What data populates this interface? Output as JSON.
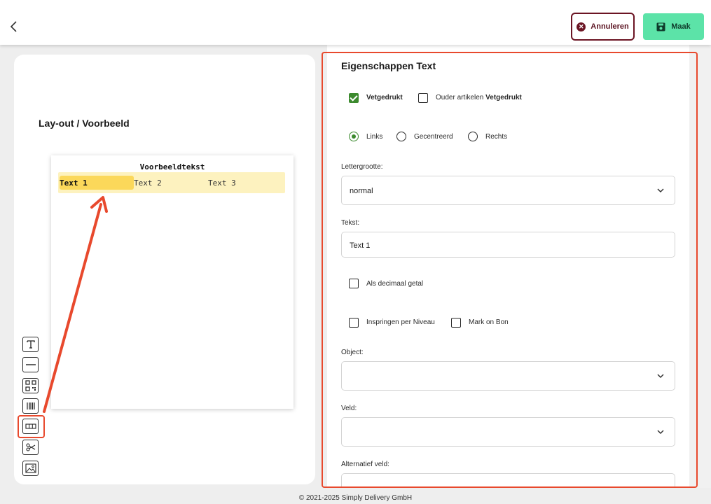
{
  "header": {
    "cancel_label": "Annuleren",
    "make_label": "Maak"
  },
  "layout": {
    "title": "Lay-out / Voorbeeld",
    "preview_title": "Voorbeeldtekst",
    "cells": [
      "Text 1",
      "Text 2",
      "Text 3"
    ]
  },
  "toolbar": {
    "tools": [
      "text-tool-icon",
      "line-tool-icon",
      "qr-code-tool-icon",
      "barcode-tool-icon",
      "columns-tool-icon",
      "cut-tool-icon",
      "image-tool-icon"
    ],
    "selected_tool": "columns-tool-icon"
  },
  "properties": {
    "title": "Eigenschappen Text",
    "bold_label": "Vetgedrukt",
    "bold_checked": true,
    "parent_items_label": "Ouder artikelen",
    "parent_items_bold": "Vetgedrukt",
    "parent_items_checked": false,
    "align_left": "Links",
    "align_center": "Gecentreerd",
    "align_right": "Rechts",
    "align_selected": "Links",
    "font_size_label": "Lettergrootte:",
    "font_size_value": "normal",
    "text_label": "Tekst:",
    "text_value": "Text 1",
    "decimal_label": "Als decimaal getal",
    "indent_label": "Inspringen per Niveau",
    "mark_label": "Mark on Bon",
    "object_label": "Object:",
    "object_value": "",
    "field_label": "Veld:",
    "field_value": "",
    "alt_field_label": "Alternatief veld:"
  },
  "footer": {
    "copyright": "© 2021-2025 Simply Delivery GmbH"
  },
  "colors": {
    "accent_green": "#5ce3a8",
    "cancel_border": "#6b1423",
    "checkbox_green": "#3c8a2e",
    "highlight_red": "#e8492d",
    "row_yellow": "#fdf2bf"
  }
}
